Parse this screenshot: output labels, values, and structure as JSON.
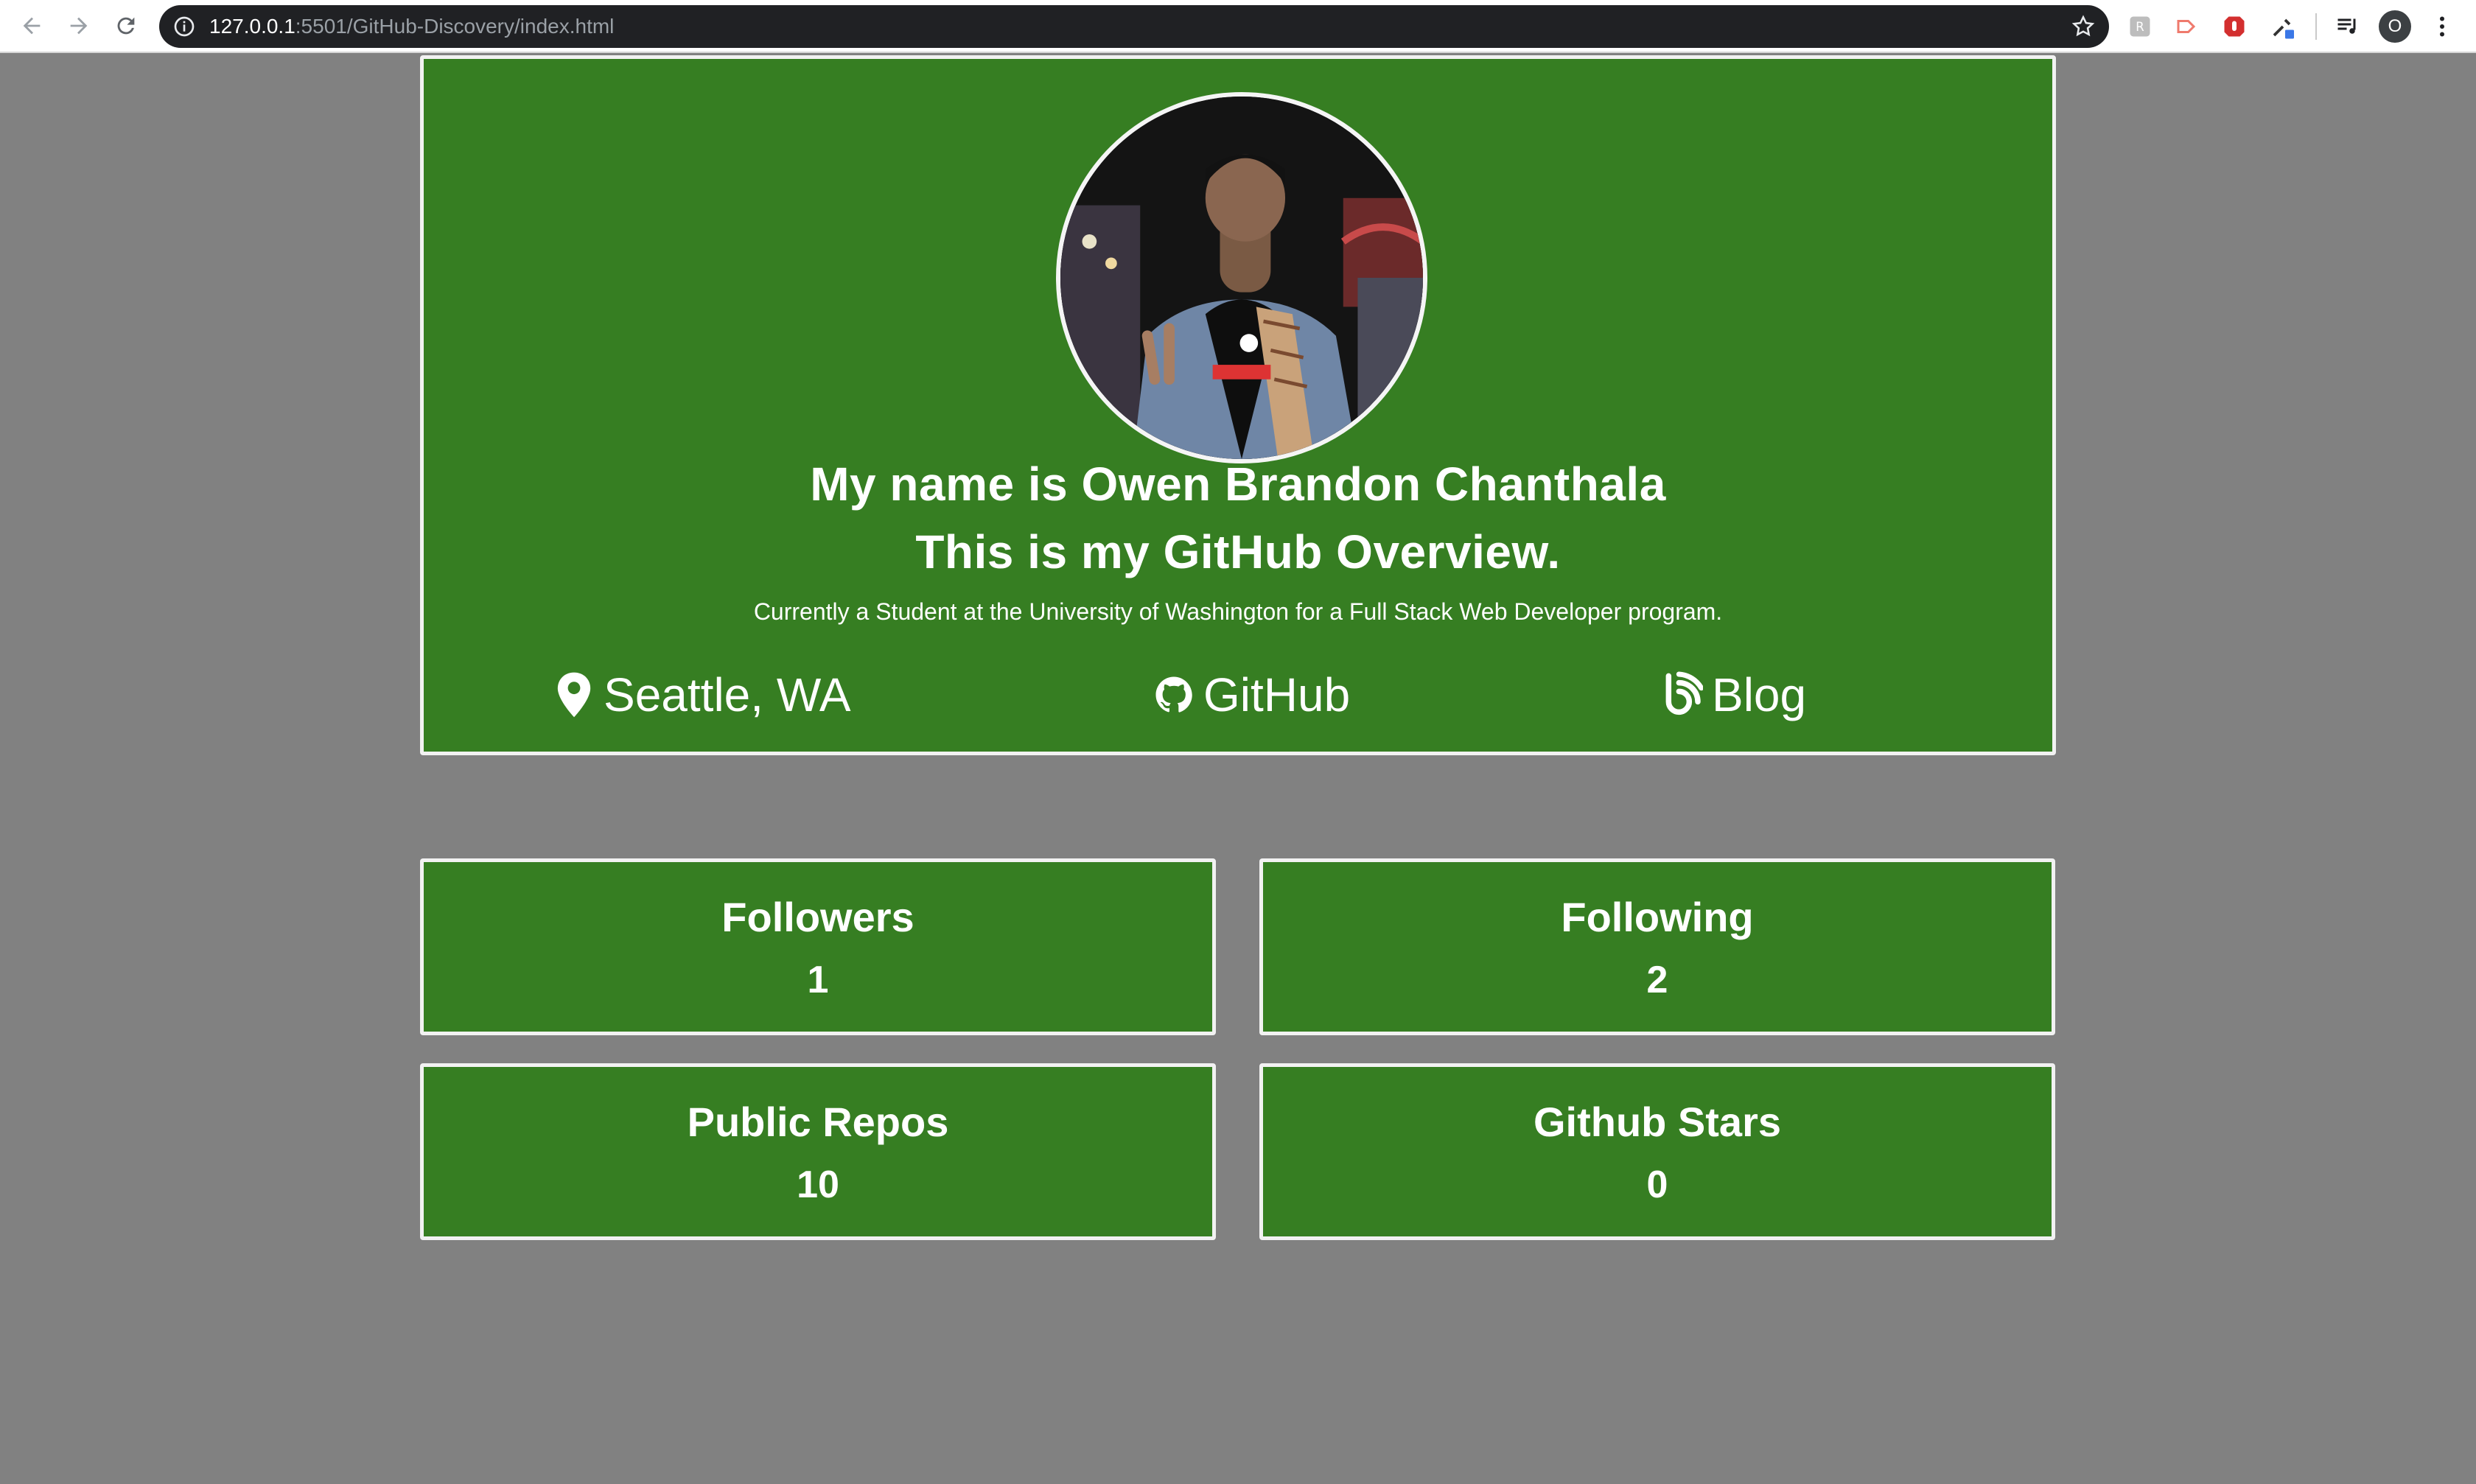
{
  "browser": {
    "url_host": "127.0.0.1",
    "url_rest": ":5501/GitHub-Discovery/index.html",
    "profile_initial": "O"
  },
  "profile": {
    "heading_line1": "My name is Owen Brandon Chanthala",
    "heading_line2": "This is my GitHub Overview.",
    "bio": "Currently a Student at the University of Washington for a Full Stack Web Developer program.",
    "location": "Seattle, WA",
    "github_label": "GitHub",
    "blog_label": "Blog"
  },
  "stats": [
    {
      "label": "Followers",
      "value": "1"
    },
    {
      "label": "Following",
      "value": "2"
    },
    {
      "label": "Public Repos",
      "value": "10"
    },
    {
      "label": "Github Stars",
      "value": "0"
    }
  ],
  "colors": {
    "card_green": "#367e22",
    "page_gray": "#818181",
    "card_border": "#f2f2f2"
  },
  "icons": [
    "map-marker-icon",
    "github-icon",
    "blogger-icon"
  ]
}
